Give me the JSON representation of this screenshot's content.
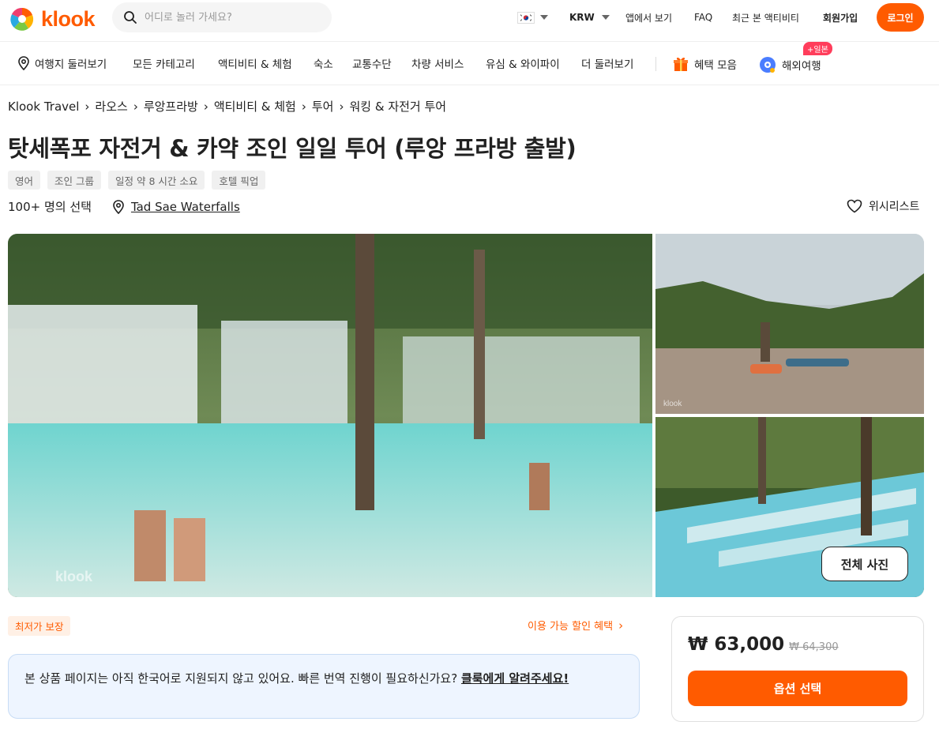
{
  "header": {
    "logo_text": "klook",
    "search_placeholder": "어디로 놀러 가세요?",
    "currency": "KRW",
    "links": [
      "앱에서 보기",
      "FAQ",
      "최근 본 액티비티",
      "회원가입"
    ],
    "login_label": "로그인"
  },
  "categories": {
    "items": [
      "여행지 둘러보기",
      "모든 카테고리",
      "액티비티 & 체험",
      "숙소",
      "교통수단",
      "차량 서비스",
      "유심 & 와이파이",
      "더 둘러보기"
    ],
    "benefits": "혜택 모음",
    "overseas": "해외여행",
    "overseas_badge": "+일본"
  },
  "breadcrumb": [
    "Klook Travel",
    "라오스",
    "루앙프라방",
    "액티비티 & 체험",
    "투어",
    "워킹 & 자전거 투어"
  ],
  "activity": {
    "title": "탓세폭포 자전거 & 카약 조인 일일 투어 (루앙 프라방 출발)",
    "tags": [
      "영어",
      "조인 그룹",
      "일정 약 8 시간 소요",
      "호텔 픽업"
    ],
    "booked": "100+ 명의 선택",
    "location": "Tad Sae Waterfalls",
    "wishlist": "위시리스트"
  },
  "gallery": {
    "view_all": "전체 사진",
    "watermark": "klook"
  },
  "offer": {
    "lowest_price_badge": "최저가 보장",
    "discounts_link": "이용 가능 할인 혜택",
    "notice_text": "본 상품 페이지는 아직 한국어로 지원되지 않고 있어요. 빠른 번역 진행이 필요하신가요? ",
    "notice_link": "클룩에게 알려주세요!",
    "price_now": "₩ 63,000",
    "price_old": "₩ 64,300",
    "select_option": "옵션 선택"
  },
  "colors": {
    "brand": "#ff5b00",
    "notice_bg": "#eef5ff"
  }
}
